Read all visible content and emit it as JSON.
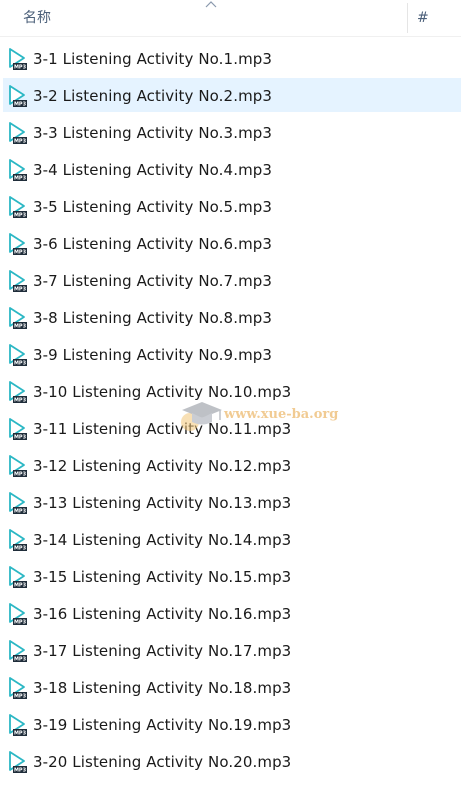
{
  "header": {
    "name_column": "名称",
    "number_column": "#"
  },
  "files": [
    {
      "name": "3-1 Listening Activity No.1.mp3",
      "icon": "mp3-file-icon",
      "selected": false
    },
    {
      "name": "3-2 Listening Activity No.2.mp3",
      "icon": "mp3-file-icon",
      "selected": true
    },
    {
      "name": "3-3 Listening Activity No.3.mp3",
      "icon": "mp3-file-icon",
      "selected": false
    },
    {
      "name": "3-4 Listening Activity No.4.mp3",
      "icon": "mp3-file-icon",
      "selected": false
    },
    {
      "name": "3-5 Listening Activity No.5.mp3",
      "icon": "mp3-file-icon",
      "selected": false
    },
    {
      "name": "3-6 Listening Activity No.6.mp3",
      "icon": "mp3-file-icon",
      "selected": false
    },
    {
      "name": "3-7 Listening Activity No.7.mp3",
      "icon": "mp3-file-icon",
      "selected": false
    },
    {
      "name": "3-8 Listening Activity No.8.mp3",
      "icon": "mp3-file-icon",
      "selected": false
    },
    {
      "name": "3-9 Listening Activity No.9.mp3",
      "icon": "mp3-file-icon",
      "selected": false
    },
    {
      "name": "3-10 Listening Activity No.10.mp3",
      "icon": "mp3-file-icon",
      "selected": false
    },
    {
      "name": "3-11 Listening Activity No.11.mp3",
      "icon": "mp3-file-icon",
      "selected": false
    },
    {
      "name": "3-12 Listening Activity No.12.mp3",
      "icon": "mp3-file-icon",
      "selected": false
    },
    {
      "name": "3-13 Listening Activity No.13.mp3",
      "icon": "mp3-file-icon",
      "selected": false
    },
    {
      "name": "3-14 Listening Activity No.14.mp3",
      "icon": "mp3-file-icon",
      "selected": false
    },
    {
      "name": "3-15 Listening Activity No.15.mp3",
      "icon": "mp3-file-icon",
      "selected": false
    },
    {
      "name": "3-16 Listening Activity No.16.mp3",
      "icon": "mp3-file-icon",
      "selected": false
    },
    {
      "name": "3-17 Listening Activity No.17.mp3",
      "icon": "mp3-file-icon",
      "selected": false
    },
    {
      "name": "3-18 Listening Activity No.18.mp3",
      "icon": "mp3-file-icon",
      "selected": false
    },
    {
      "name": "3-19 Listening Activity No.19.mp3",
      "icon": "mp3-file-icon",
      "selected": false
    },
    {
      "name": "3-20 Listening Activity No.20.mp3",
      "icon": "mp3-file-icon",
      "selected": false
    }
  ],
  "watermark": {
    "text": "www.xue-ba.org"
  },
  "colors": {
    "selection": "#e5f3ff",
    "header_text": "#4c607a",
    "icon_accent": "#2bb7c4",
    "watermark": "#e6a23c"
  }
}
